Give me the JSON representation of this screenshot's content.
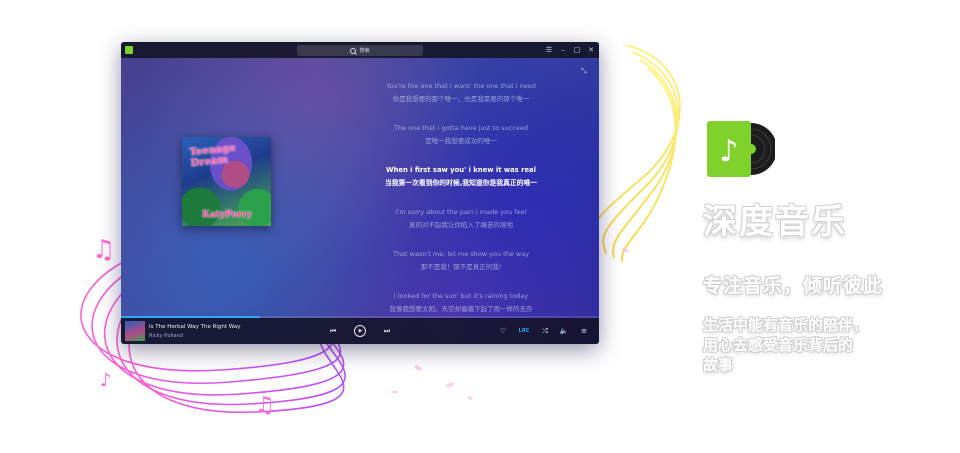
{
  "window": {
    "search_placeholder": "搜索",
    "controls": {
      "menu_icon": "menu-icon",
      "minimize_icon": "minimize-icon",
      "maximize_icon": "maximize-icon",
      "close_icon": "close-icon"
    }
  },
  "album": {
    "art_title": "Teenage Dream",
    "art_name": "KatyPerry"
  },
  "lyrics": [
    {
      "en": "You're the one that i want' the one that i need",
      "zh": "你是我想要的那个唯一，也是我需要的那个唯一",
      "current": false
    },
    {
      "en": "The one that i gotta have just to succeed",
      "zh": "是唯一我想要成功的唯一",
      "current": false
    },
    {
      "en": "When i first saw you' i knew it was real",
      "zh": "当我第一次看到你的时候,我知道你是我真正的唯一",
      "current": true
    },
    {
      "en": "I'm sorry about the pain i made you feel",
      "zh": "真的对不起我让你陷入了痛苦的境地",
      "current": false
    },
    {
      "en": "That wasn't me; let me show you the way",
      "zh": "那不是我！那不是真正的我!",
      "current": false
    },
    {
      "en": "I looked for the sun' but it's raining today",
      "zh": "就像我想要太阳。天空却偏偏下起了雨一样的无奈",
      "current": false
    }
  ],
  "player": {
    "track_title": "Is The Herbal Way The Right Way",
    "track_artist": "Ricky Holland",
    "progress": 0.29,
    "lrc_label": "LRC"
  },
  "brand": {
    "title": "深度音乐",
    "slogan": "专注音乐，倾听彼此",
    "desc_line1": "生活中能有音乐的陪伴，",
    "desc_line2": "用心去感受音乐背后的",
    "desc_line3": "故事"
  },
  "colors": {
    "accent": "#2ca7f8",
    "brand_green": "#7fd22c"
  }
}
